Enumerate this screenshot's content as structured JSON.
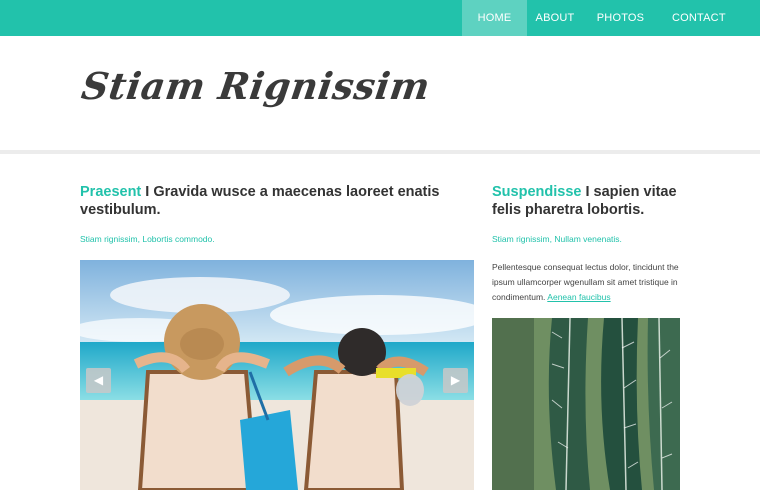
{
  "nav": {
    "items": [
      {
        "label": "HOME"
      },
      {
        "label": "ABOUT"
      },
      {
        "label": "PHOTOS"
      },
      {
        "label": "CONTACT"
      }
    ],
    "active_index": 0,
    "bar_color": "#22c2ab",
    "active_color": "#5ed2c1"
  },
  "header": {
    "logo_text": "Stiam Rignissim"
  },
  "main": {
    "title_accent": "Praesent",
    "title_rest": " I Gravida wusce a maecenas laoreet enatis vestibulum.",
    "meta": "Stiam rignissim, Lobortis commodo.",
    "slider": {
      "image": "beach-photo",
      "prev_icon": "arrow-left-icon",
      "next_icon": "arrow-right-icon"
    }
  },
  "side": {
    "title_accent": "Suspendisse",
    "title_rest": " I sapien vitae felis pharetra lobortis.",
    "meta": "Stiam rignissim, Nullam venenatis.",
    "body": "Pellentesque consequat lectus dolor, tincidunt the ipsum ullamcorper wgenullam sit amet tristique in condimentum.",
    "body_link": "Aenean faucibus",
    "image": "cactus-photo"
  },
  "colors": {
    "accent": "#22c2ab",
    "text": "#333333"
  }
}
